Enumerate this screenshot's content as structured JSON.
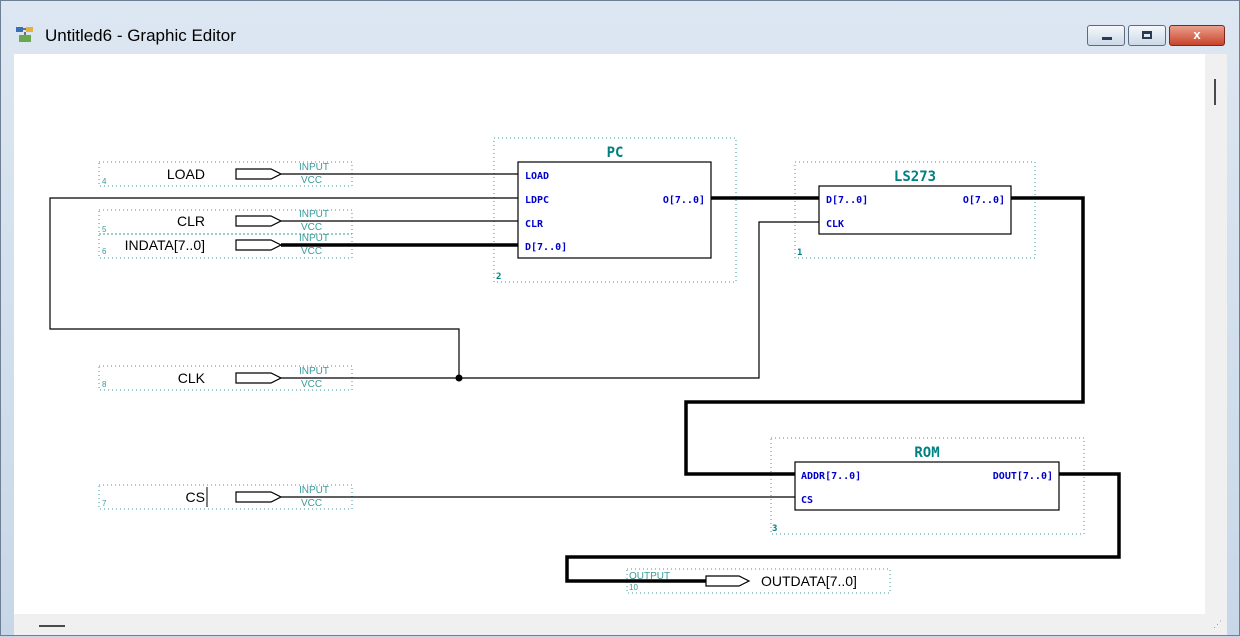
{
  "window": {
    "title": "Untitled6 - Graphic Editor",
    "close_glyph": "x",
    "icons": {
      "app": "graphic-editor-icon",
      "minimize": "minimize-icon",
      "maximize": "maximize-icon",
      "close": "close-icon"
    }
  },
  "schematic": {
    "inputs": [
      {
        "name": "LOAD",
        "num": "4",
        "type": "INPUT",
        "vcc": "VCC"
      },
      {
        "name": "CLR",
        "num": "5",
        "type": "INPUT",
        "vcc": "VCC"
      },
      {
        "name": "INDATA[7..0]",
        "num": "6",
        "type": "INPUT",
        "vcc": "VCC"
      },
      {
        "name": "CLK",
        "num": "8",
        "type": "INPUT",
        "vcc": "VCC"
      },
      {
        "name": "CS",
        "num": "7",
        "type": "INPUT",
        "vcc": "VCC"
      }
    ],
    "output": {
      "name": "OUTDATA[7..0]",
      "num": "10",
      "type": "OUTPUT"
    },
    "blocks": {
      "pc": {
        "title": "PC",
        "num": "2",
        "ports": {
          "load": "LOAD",
          "ldpc": "LDPC",
          "clr": "CLR",
          "d": "D[7..0]",
          "o": "O[7..0]"
        }
      },
      "ls273": {
        "title": "LS273",
        "num": "1",
        "ports": {
          "d": "D[7..0]",
          "o": "O[7..0]",
          "clk": "CLK"
        }
      },
      "rom": {
        "title": "ROM",
        "num": "3",
        "ports": {
          "addr": "ADDR[7..0]",
          "dout": "DOUT[7..0]",
          "cs": "CS"
        }
      }
    }
  },
  "colors": {
    "block_title": "#008080",
    "port_text": "#0000cc",
    "pin_label": "#3a9a9a",
    "wire": "#000000"
  }
}
